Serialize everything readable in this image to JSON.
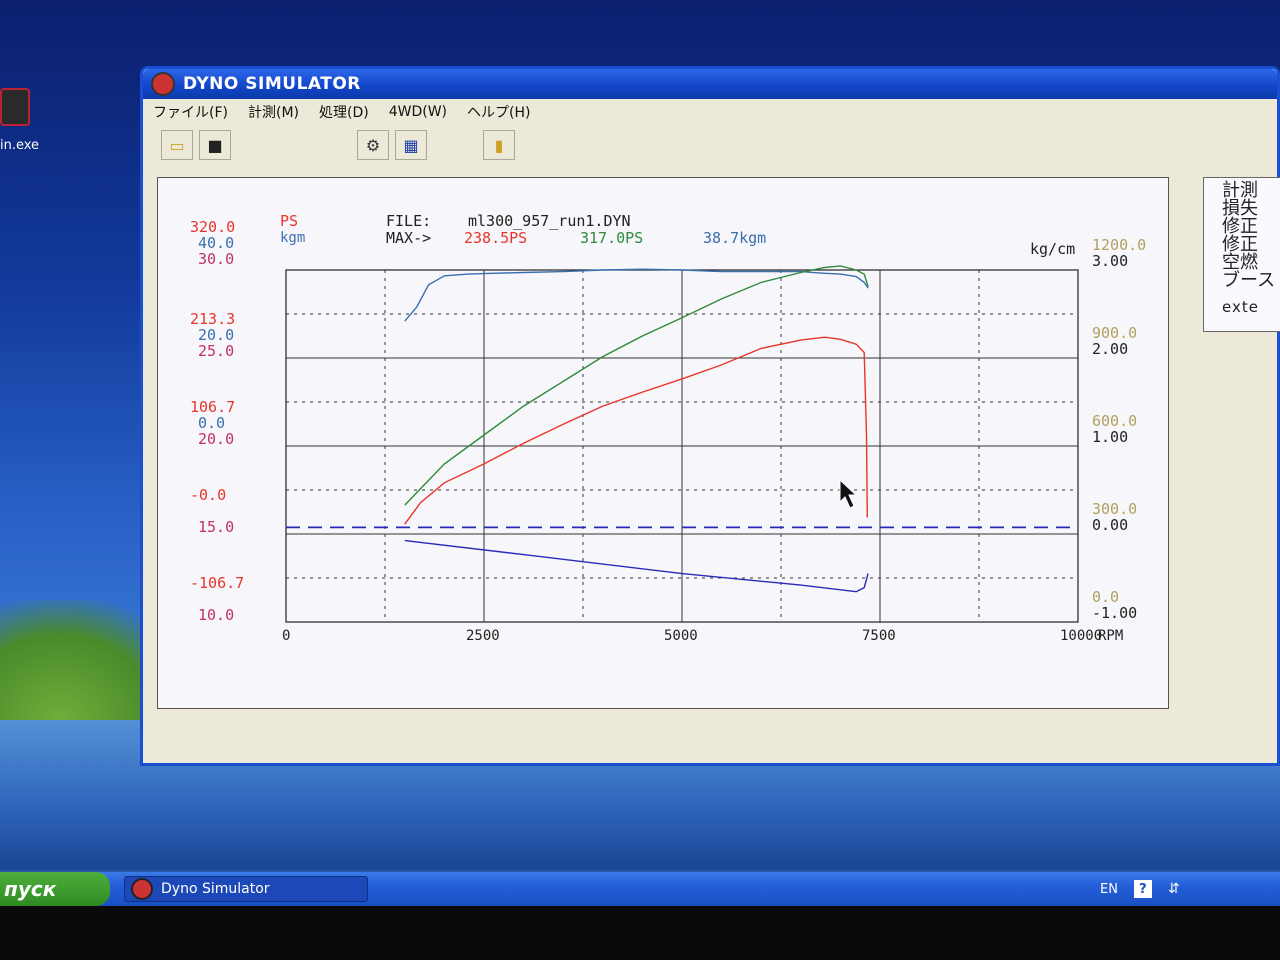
{
  "desktop": {
    "icon_label": "in.exe"
  },
  "window": {
    "title": "DYNO SIMULATOR",
    "menu": [
      "ファイル(F)",
      "計測(M)",
      "処理(D)",
      "4WD(W)",
      "ヘルプ(H)"
    ],
    "toolbar": [
      "open-folder-icon",
      "save-icon",
      "settings-icon",
      "display-icon",
      "exit-door-icon"
    ]
  },
  "side_panel": {
    "lines": [
      "計測",
      "損失",
      "修正",
      "修正",
      "空燃",
      "ブース"
    ],
    "ext_text": "exte"
  },
  "chart_header": {
    "ps_label": "PS",
    "kgm_label": "kgm",
    "file_label": "FILE:",
    "file_name": "ml300_957_run1.DYN",
    "max_label": "MAX->",
    "max_ps_1": "238.5PS",
    "max_ps_2": "317.0PS",
    "max_kgm": "38.7kgm",
    "right_unit": "kg/cm"
  },
  "chart_data": {
    "type": "line",
    "x_label": "RPM",
    "xlim": [
      0,
      10000
    ],
    "x_ticks": [
      "0",
      "2500",
      "5000",
      "7500",
      "10000"
    ],
    "left_ticks": [
      {
        "ps": "320.0",
        "kgm": "40.0",
        "pink": "30.0"
      },
      {
        "ps": "213.3",
        "kgm": "20.0",
        "pink": "25.0"
      },
      {
        "ps": "106.7",
        "kgm": "0.0",
        "pink": "20.0"
      },
      {
        "ps": "-0.0",
        "kgm": "",
        "pink": "15.0"
      },
      {
        "ps": "-106.7",
        "kgm": "",
        "pink": "10.0"
      }
    ],
    "right_ticks": [
      {
        "top": "1200.0",
        "bottom": "3.00"
      },
      {
        "top": "900.0",
        "bottom": "2.00"
      },
      {
        "top": "600.0",
        "bottom": "1.00"
      },
      {
        "top": "300.0",
        "bottom": "0.00"
      },
      {
        "top": "0.0",
        "bottom": "-1.00"
      }
    ],
    "colors": {
      "ps_red": "#e8352a",
      "kgm_blue": "#3a6fae",
      "green": "#2f8a3a",
      "navy": "#2a2ab8",
      "tan": "#b0a060",
      "pink": "#c0306a"
    },
    "series": [
      {
        "color": "blue",
        "ylim": [
          -106.7,
          320.0
        ],
        "x": [
          1500,
          1650,
          1800,
          2000,
          2300,
          2600,
          3000,
          3500,
          4000,
          4500,
          5000,
          5500,
          6000,
          6500,
          6800,
          7000,
          7200,
          7300,
          7350
        ],
        "y": [
          258,
          275,
          302,
          313,
          315,
          316,
          317,
          318,
          320,
          321,
          320,
          318,
          318,
          318,
          316,
          315,
          312,
          305,
          298
        ]
      },
      {
        "color": "green",
        "ylim": [
          -106.7,
          320.0
        ],
        "x": [
          1500,
          1700,
          2000,
          2500,
          3000,
          3500,
          4000,
          4500,
          5000,
          5500,
          6000,
          6500,
          6800,
          7000,
          7200,
          7300,
          7350
        ],
        "y": [
          35,
          55,
          85,
          120,
          155,
          185,
          215,
          240,
          262,
          285,
          305,
          317,
          323,
          325,
          320,
          315,
          300
        ]
      },
      {
        "color": "red",
        "ylim": [
          -106.7,
          320.0
        ],
        "x": [
          1500,
          1700,
          2000,
          2500,
          3000,
          3500,
          4000,
          4500,
          5000,
          5500,
          6000,
          6500,
          6800,
          7000,
          7200,
          7300,
          7330,
          7340
        ],
        "y": [
          12,
          38,
          62,
          85,
          110,
          133,
          155,
          172,
          188,
          205,
          225,
          235,
          238.5,
          236,
          230,
          220,
          120,
          20
        ]
      },
      {
        "color": "navy_dashed",
        "ylim": [
          -106.7,
          320.0
        ],
        "x": [
          0,
          10000
        ],
        "y": [
          8,
          8
        ]
      },
      {
        "color": "navy",
        "ylim": [
          -106.7,
          320.0
        ],
        "x": [
          1500,
          3000,
          5000,
          6500,
          7200,
          7300,
          7350
        ],
        "y": [
          -8,
          -25,
          -48,
          -62,
          -70,
          -65,
          -48
        ]
      }
    ]
  },
  "taskbar": {
    "start_label": "пуск",
    "task_label": "Dyno Simulator",
    "lang": "EN",
    "help": "?"
  }
}
